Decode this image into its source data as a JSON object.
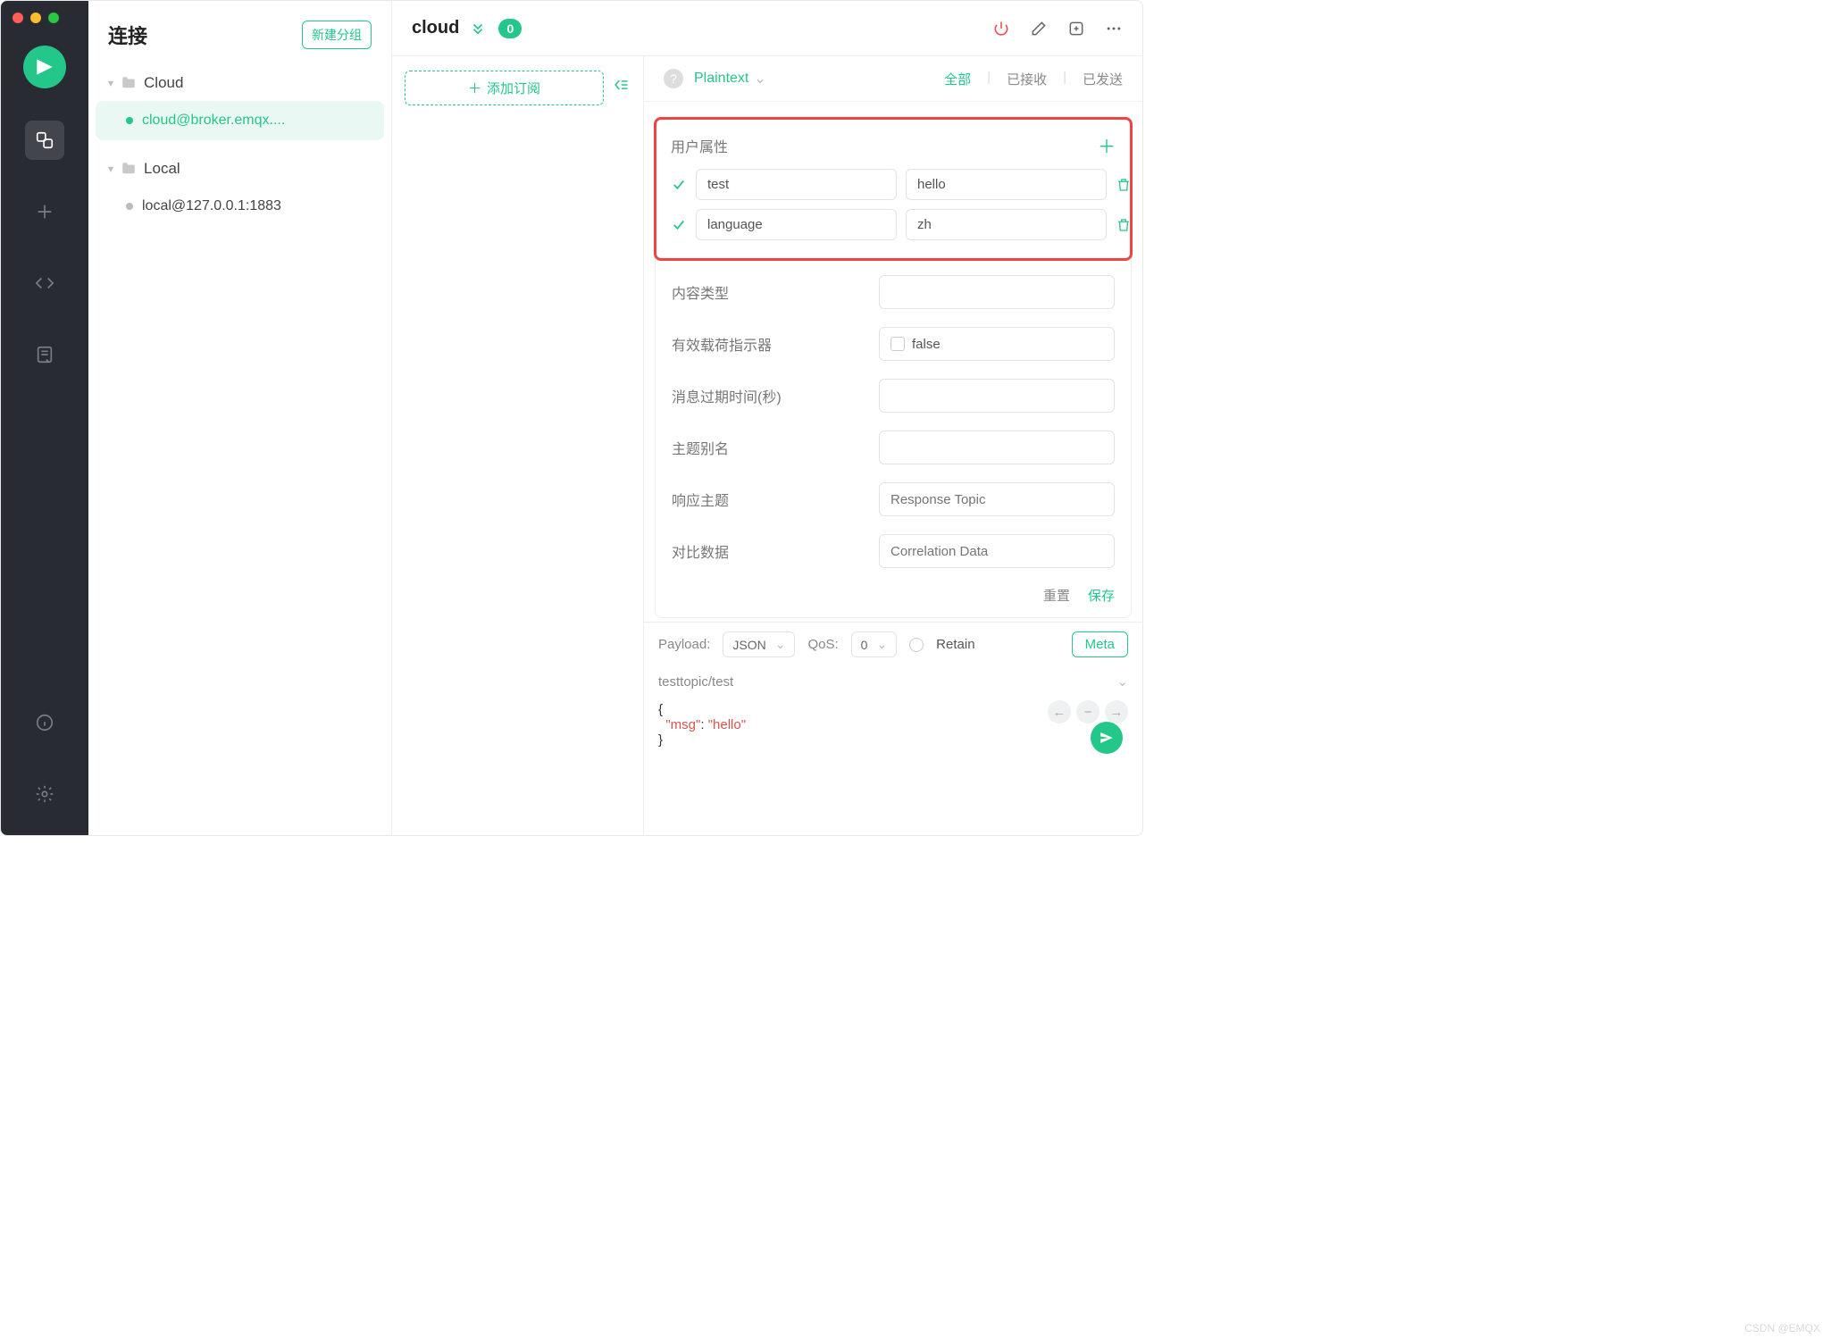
{
  "sidebar_title": "连接",
  "new_group_label": "新建分组",
  "tree": {
    "groups": [
      {
        "name": "Cloud",
        "items": [
          {
            "label": "cloud@broker.emqx....",
            "status": "online"
          }
        ]
      },
      {
        "name": "Local",
        "items": [
          {
            "label": "local@127.0.0.1:1883",
            "status": "offline"
          }
        ]
      }
    ]
  },
  "connection": {
    "name": "cloud",
    "unread": "0"
  },
  "add_subscription_label": "添加订阅",
  "viewer": {
    "format": "Plaintext",
    "tabs": {
      "all": "全部",
      "received": "已接收",
      "sent": "已发送"
    }
  },
  "meta": {
    "user_props_label": "用户属性",
    "rows": [
      {
        "key": "test",
        "value": "hello"
      },
      {
        "key": "language",
        "value": "zh"
      }
    ],
    "content_type_label": "内容类型",
    "payload_indicator_label": "有效载荷指示器",
    "payload_indicator_value": "false",
    "expiry_label": "消息过期时间(秒)",
    "topic_alias_label": "主题别名",
    "response_topic_label": "响应主题",
    "response_topic_placeholder": "Response Topic",
    "correlation_label": "对比数据",
    "correlation_placeholder": "Correlation Data",
    "reset_label": "重置",
    "save_label": "保存"
  },
  "publish": {
    "payload_label": "Payload:",
    "payload_format": "JSON",
    "qos_label": "QoS:",
    "qos_value": "0",
    "retain_label": "Retain",
    "meta_button": "Meta",
    "topic": "testtopic/test",
    "body_key": "\"msg\"",
    "body_val": "\"hello\""
  },
  "watermark": "CSDN @EMQX"
}
